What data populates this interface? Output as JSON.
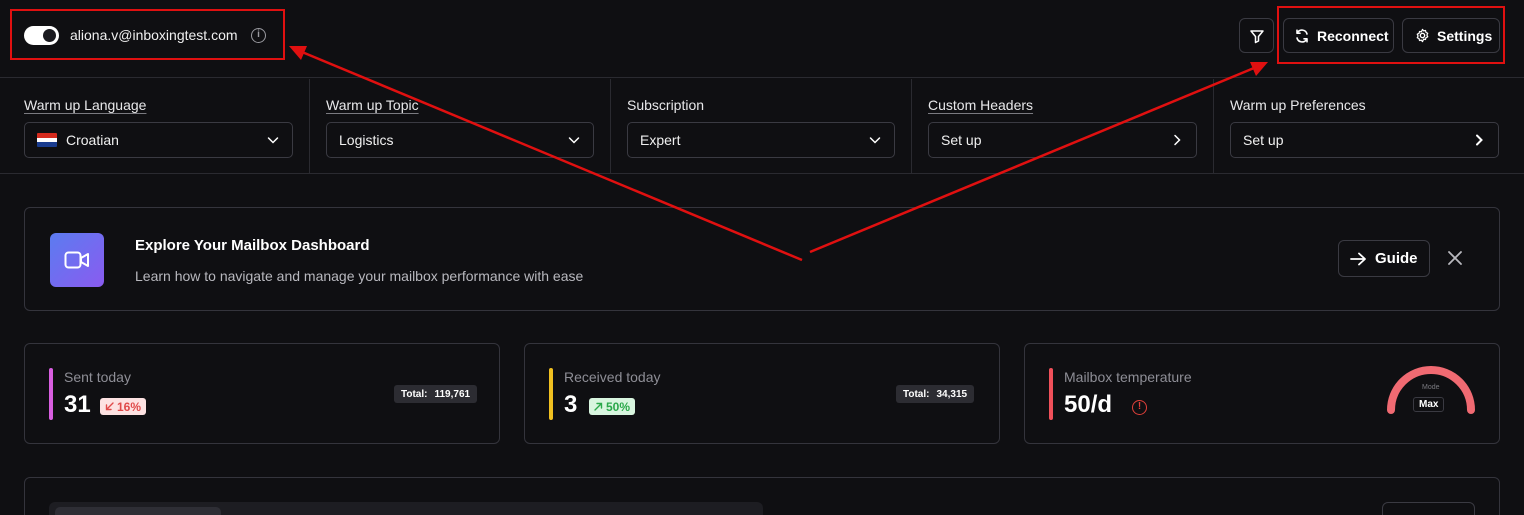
{
  "header": {
    "email": "aliona.v@inboxingtest.com",
    "reconnect_label": "Reconnect",
    "settings_label": "Settings"
  },
  "config": [
    {
      "label": "Warm up Language",
      "value": "Croatian",
      "control": "dropdown"
    },
    {
      "label": "Warm up Topic",
      "value": "Logistics",
      "control": "dropdown"
    },
    {
      "label": "Subscription",
      "value": "Expert",
      "control": "dropdown"
    },
    {
      "label": "Custom Headers",
      "value": "Set up",
      "control": "link"
    },
    {
      "label": "Warm up Preferences",
      "value": "Set up",
      "control": "link"
    }
  ],
  "banner": {
    "title": "Explore Your Mailbox Dashboard",
    "subtitle": "Learn how to navigate and manage your mailbox performance with ease",
    "guide_label": "Guide"
  },
  "stats": {
    "sent": {
      "label": "Sent today",
      "value": "31",
      "change": "16%",
      "total_label": "Total:",
      "total": "119,761",
      "color": "#d85ee0"
    },
    "received": {
      "label": "Received today",
      "value": "3",
      "change": "50%",
      "total_label": "Total:",
      "total": "34,315",
      "color": "#f0c020"
    },
    "temperature": {
      "label": "Mailbox temperature",
      "value": "50/d",
      "mode_label": "Mode",
      "mode_value": "Max",
      "color": "#f0505a"
    }
  },
  "colors": {
    "background": "#0f0f12",
    "border": "#34343c",
    "highlight": "#e01010",
    "down": "#e04a4a",
    "up": "#2aa84a"
  }
}
